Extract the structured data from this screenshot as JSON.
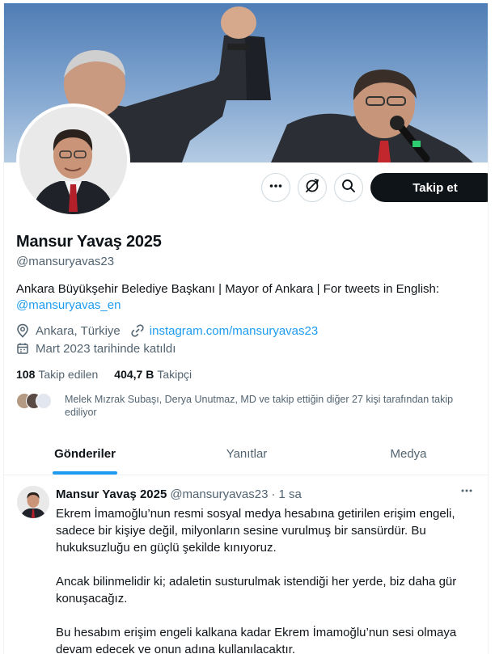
{
  "profile": {
    "name": "Mansur Yavaş 2025",
    "handle": "@mansuryavas23",
    "bio_text": "Ankara Büyükşehir Belediye Başkanı | Mayor of Ankara | For tweets in English:",
    "bio_mention": "@mansuryavas_en",
    "location": "Ankara, Türkiye",
    "website": "instagram.com/mansuryavas23",
    "joined": "Mart 2023 tarihinde katıldı",
    "following_count": "108",
    "following_label": "Takip edilen",
    "followers_count": "404,7 B",
    "followers_label": "Takipçi",
    "followed_by_text": "Melek Mızrak Subaşı, Derya Unutmaz, MD ve takip ettiğin diğer 27 kişi tarafından takip ediliyor"
  },
  "actions": {
    "more_icon": "more-horizontal-icon",
    "notify_icon": "notifications-off-icon",
    "search_icon": "search-icon",
    "follow_label": "Takip et"
  },
  "tabs": [
    {
      "label": "Gönderiler",
      "active": true
    },
    {
      "label": "Yanıtlar",
      "active": false
    },
    {
      "label": "Medya",
      "active": false
    }
  ],
  "tweet": {
    "author_name": "Mansur Yavaş 2025",
    "author_handle": "@mansuryavas23",
    "separator": "·",
    "time": "1 sa",
    "paragraphs": [
      "Ekrem İmamoğlu’nun resmi sosyal medya hesabına getirilen erişim engeli, sadece bir kişiye değil, milyonların sesine vurulmuş bir sansürdür. Bu hukuksuzluğu en güçlü şekilde kınıyoruz.",
      "Ancak bilinmelidir ki; adaletin susturulmak istendiği her yerde, biz daha gür konuşacağız.",
      "Bu hesabım erişim engeli kalkana kadar Ekrem İmamoğlu’nun sesi olmaya devam edecek ve onun adına kullanılacaktır."
    ]
  },
  "colors": {
    "accent": "#1d9bf0",
    "text_primary": "#0f1419",
    "text_secondary": "#536471",
    "border": "#cfd9de"
  }
}
